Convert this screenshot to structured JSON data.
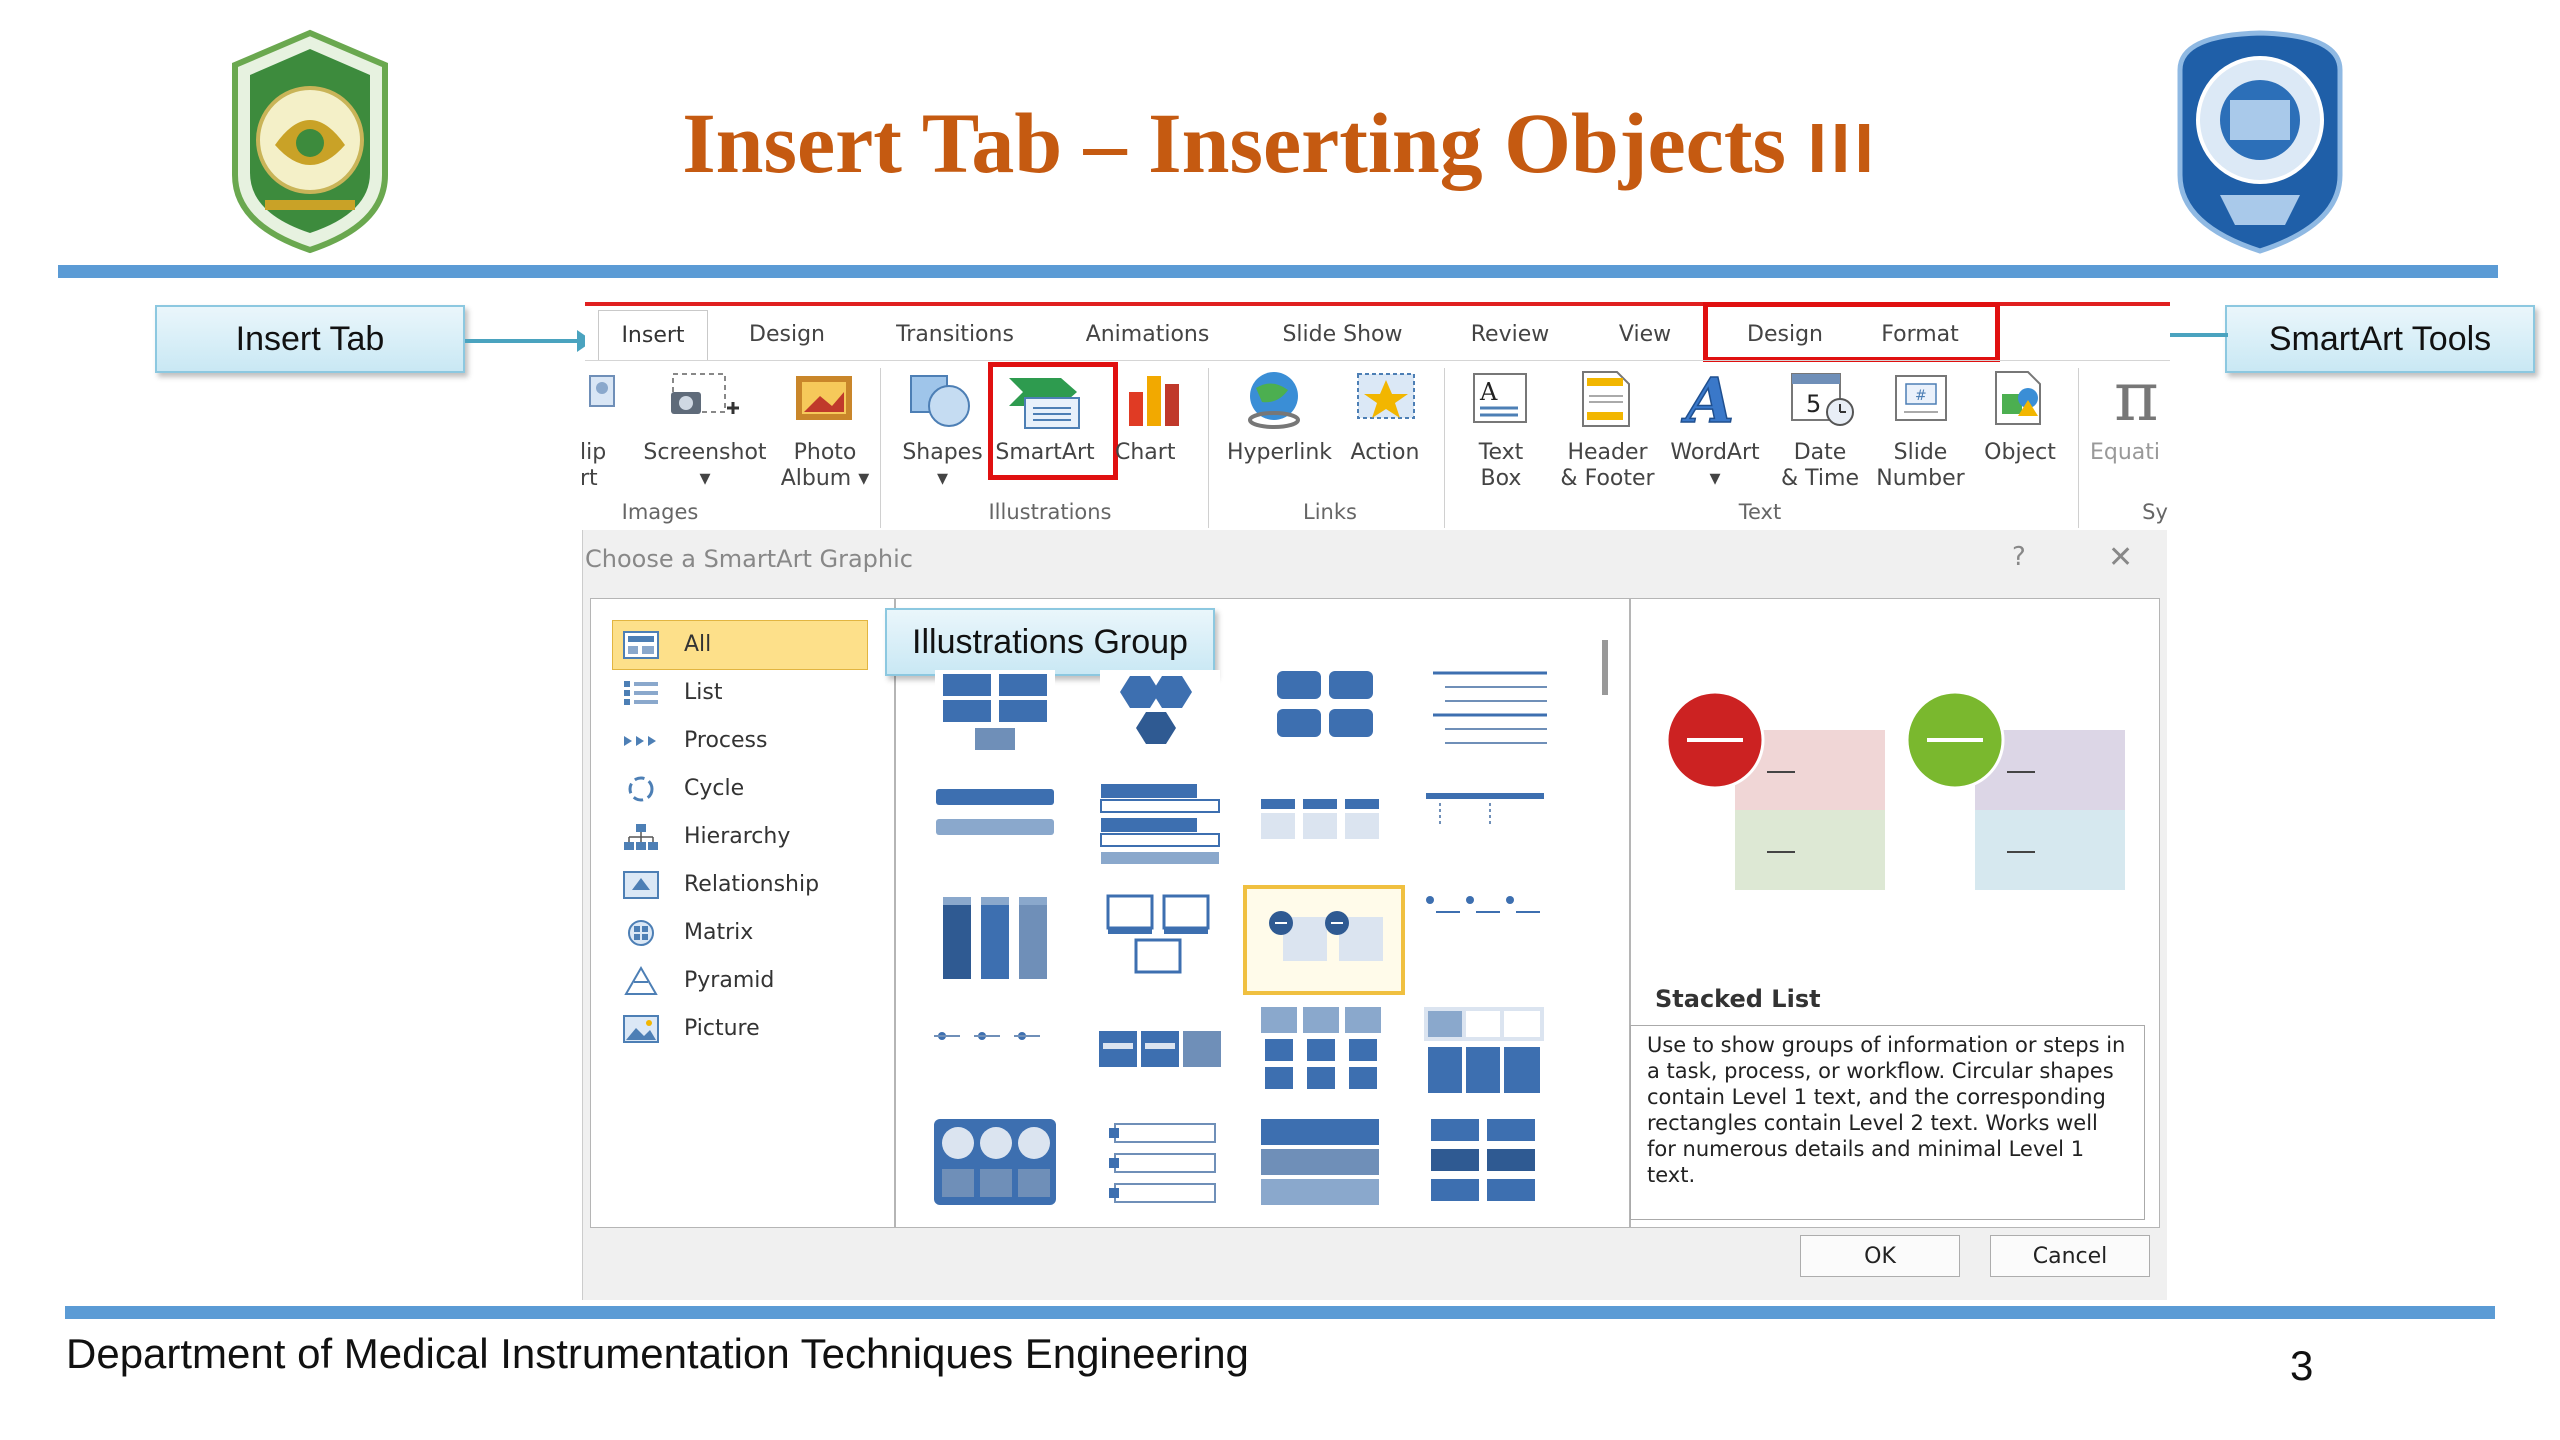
{
  "slide": {
    "title": "Insert Tab – Inserting Objects",
    "title_suffix": "III",
    "footer": "Department of Medical Instrumentation Techniques Engineering",
    "page_number": "3",
    "accent": "#c55a11",
    "rule_color": "#5b9bd5"
  },
  "callouts": {
    "insert_tab": "Insert Tab",
    "smartart_tools": "SmartArt Tools",
    "illustrations_group": "Illustrations Group"
  },
  "ribbon": {
    "tabs": [
      "Insert",
      "Design",
      "Transitions",
      "Animations",
      "Slide Show",
      "Review",
      "View",
      "Design",
      "Format"
    ],
    "clip_art": [
      "lip",
      "rt"
    ],
    "buttons": {
      "screenshot": "Screenshot",
      "photo_album_1": "Photo",
      "photo_album_2": "Album",
      "shapes": "Shapes",
      "smartart": "SmartArt",
      "chart": "Chart",
      "hyperlink": "Hyperlink",
      "action": "Action",
      "textbox_1": "Text",
      "textbox_2": "Box",
      "header_1": "Header",
      "header_2": "& Footer",
      "wordart": "WordArt",
      "date_1": "Date",
      "date_2": "& Time",
      "slide_1": "Slide",
      "slide_2": "Number",
      "object": "Object",
      "equation": "Equati"
    },
    "groups": {
      "images": "Images",
      "illustrations": "Illustrations",
      "links": "Links",
      "text": "Text",
      "symbols": "Sy"
    }
  },
  "dialog": {
    "title": "Choose a SmartArt Graphic",
    "help": "?",
    "close": "✕",
    "categories": [
      "All",
      "List",
      "Process",
      "Cycle",
      "Hierarchy",
      "Relationship",
      "Matrix",
      "Pyramid",
      "Picture"
    ],
    "selected_category": "All",
    "preview_title": "Stacked List",
    "preview_description": "Use to show groups of information or steps in a task, process, or workflow. Circular shapes contain Level 1 text, and the corresponding rectangles contain Level 2 text. Works well for numerous details and minimal Level 1 text.",
    "ok": "OK",
    "cancel": "Cancel"
  }
}
